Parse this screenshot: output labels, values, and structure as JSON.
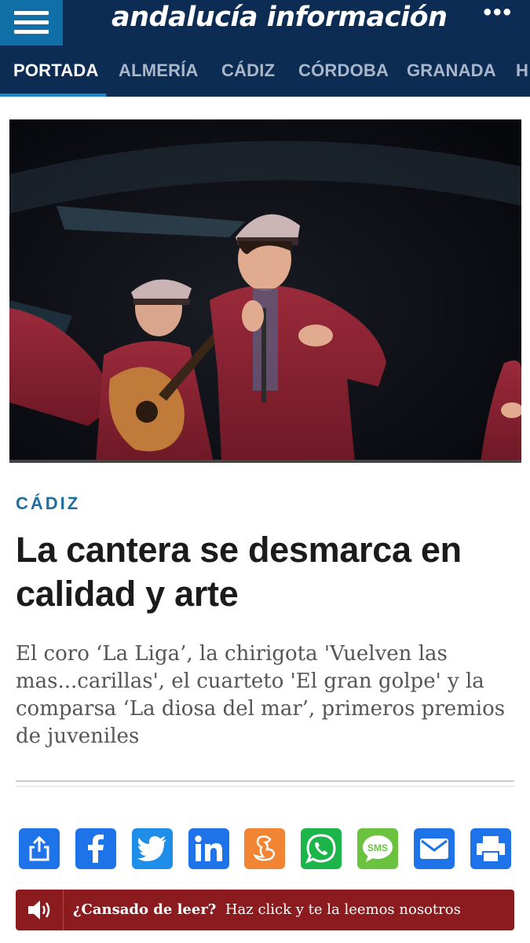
{
  "header": {
    "logo": "andalucía información",
    "more_label": "•••",
    "bg_color": "#0d2c54",
    "accent_color": "#0f6fa6"
  },
  "nav": {
    "items": [
      {
        "label": "PORTADA",
        "active": true
      },
      {
        "label": "ALMERÍA"
      },
      {
        "label": "CÁDIZ"
      },
      {
        "label": "CÓRDOBA"
      },
      {
        "label": "GRANADA"
      },
      {
        "label": "H"
      }
    ]
  },
  "article": {
    "section": "CÁDIZ",
    "headline": "La cantera se desmarca en calidad y arte",
    "subtitle": "El coro ‘La Liga’, la chirigota 'Vuelven las mas...carillas', el cuarteto 'El gran golpe' y la comparsa ‘La diosa del mar’, primeros premios de juveniles"
  },
  "share": [
    {
      "name": "share-native",
      "icon": "share-icon",
      "color": "#1e73e8"
    },
    {
      "name": "facebook",
      "icon": "facebook-icon",
      "color": "#1e73e8"
    },
    {
      "name": "twitter",
      "icon": "twitter-icon",
      "color": "#1e8ee8"
    },
    {
      "name": "linkedin",
      "icon": "linkedin-icon",
      "color": "#1e73e8"
    },
    {
      "name": "meneame",
      "icon": "meneame-icon",
      "color": "#f28533"
    },
    {
      "name": "whatsapp",
      "icon": "whatsapp-icon",
      "color": "#1cb54a"
    },
    {
      "name": "sms",
      "icon": "sms-icon",
      "color": "#6ac23f"
    },
    {
      "name": "email",
      "icon": "mail-icon",
      "color": "#1e73e8"
    },
    {
      "name": "print",
      "icon": "printer-icon",
      "color": "#1e73e8"
    }
  ],
  "listen_bar": {
    "bold_text": "¿Cansado de leer?",
    "text": "Haz click y te la leemos nosotros",
    "color": "#8c1b1f"
  }
}
